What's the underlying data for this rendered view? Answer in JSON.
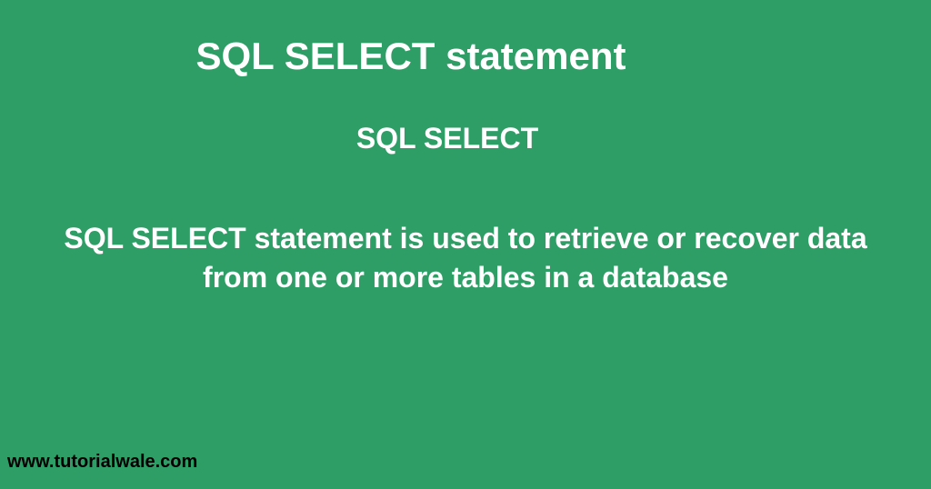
{
  "main_title": "SQL SELECT statement",
  "subtitle": "SQL SELECT",
  "description": "SQL SELECT statement is used to retrieve or recover data from one or more tables in a database",
  "footer_url": "www.tutorialwale.com"
}
